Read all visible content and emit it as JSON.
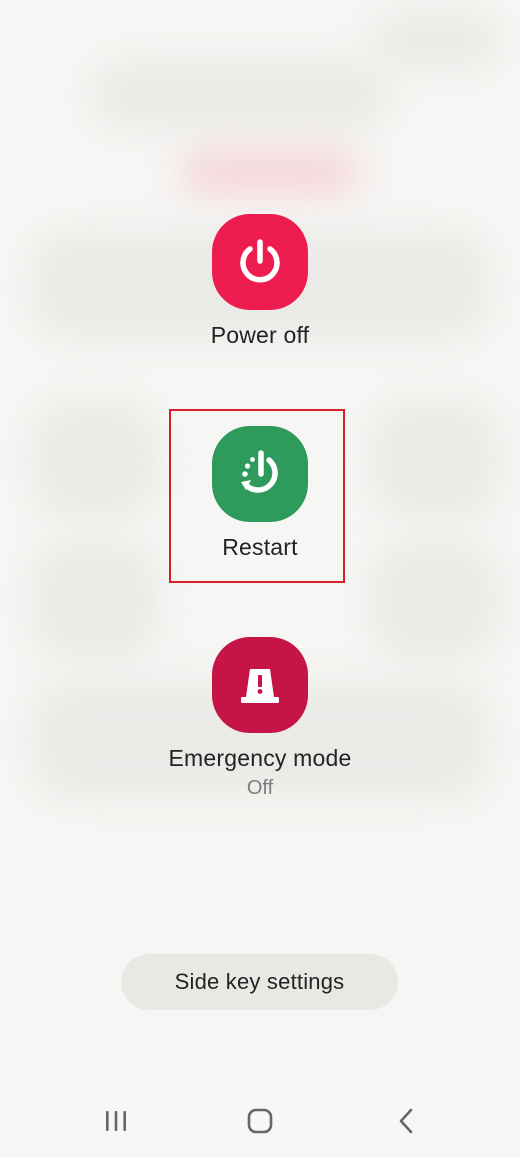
{
  "power_menu": {
    "power_off": {
      "label": "Power off",
      "color": "#ee1d4f",
      "icon": "power-icon"
    },
    "restart": {
      "label": "Restart",
      "color": "#2e9a5b",
      "icon": "restart-icon"
    },
    "emergency_mode": {
      "label": "Emergency mode",
      "status": "Off",
      "color": "#c51445",
      "icon": "emergency-beacon-icon"
    }
  },
  "side_key_settings": {
    "label": "Side key settings"
  },
  "highlight": {
    "target": "restart",
    "color": "#d6202a"
  },
  "navigation_bar": {
    "buttons": [
      "recents-icon",
      "home-icon",
      "back-icon"
    ]
  }
}
